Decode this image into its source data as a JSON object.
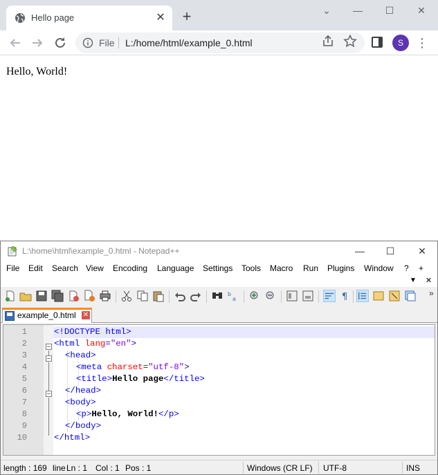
{
  "chrome": {
    "tab_title": "Hello page",
    "tab_close": "✕",
    "new_tab": "+",
    "scheme": "File",
    "url": "L:/home/html/example_0.html",
    "avatar_letter": "S",
    "page_text": "Hello, World!",
    "window_controls": [
      "⌄",
      "—",
      "☐",
      "✕"
    ]
  },
  "npp": {
    "title": "L:\\home\\html\\example_0.html - Notepad++",
    "menu": [
      "File",
      "Edit",
      "Search",
      "View",
      "Encoding",
      "Language",
      "Settings",
      "Tools",
      "Macro",
      "Run",
      "Plugins",
      "Window",
      "?",
      "+"
    ],
    "menu_row2": [
      "▼",
      "✕"
    ],
    "tab_label": "example_0.html",
    "tab_close": "✕",
    "line_numbers": [
      "1",
      "2",
      "3",
      "4",
      "5",
      "6",
      "7",
      "8",
      "9",
      "10"
    ],
    "status": {
      "length": "length : 169",
      "lines": "line",
      "ln": "Ln : 1",
      "col": "Col : 1",
      "pos": "Pos : 1",
      "eol": "Windows (CR LF)",
      "encoding": "UTF-8",
      "mode": "INS"
    },
    "code": {
      "l1_tag": "<!DOCTYPE html>",
      "l2_open": "<html ",
      "l2_attr": "lang",
      "l2_eq": "=",
      "l2_val": "\"en\"",
      "l2_close": ">",
      "l3": "<head>",
      "l4_open": "<meta ",
      "l4_attr": "charset",
      "l4_eq": "=",
      "l4_val": "\"utf-8\"",
      "l4_close": ">",
      "l5_open": "<title>",
      "l5_text": "Hello page",
      "l5_close": "</title>",
      "l6": "</head>",
      "l7": "<body>",
      "l8_open": "<p>",
      "l8_text": "Hello, World!",
      "l8_close": "</p>",
      "l9": "</body>",
      "l10": "</html>"
    }
  },
  "colors": {
    "tag": "#0000ff",
    "attribute": "#ff0000",
    "value": "#8000ff",
    "tab_accent": "#fa8c1f",
    "avatar": "#5e35b1"
  }
}
